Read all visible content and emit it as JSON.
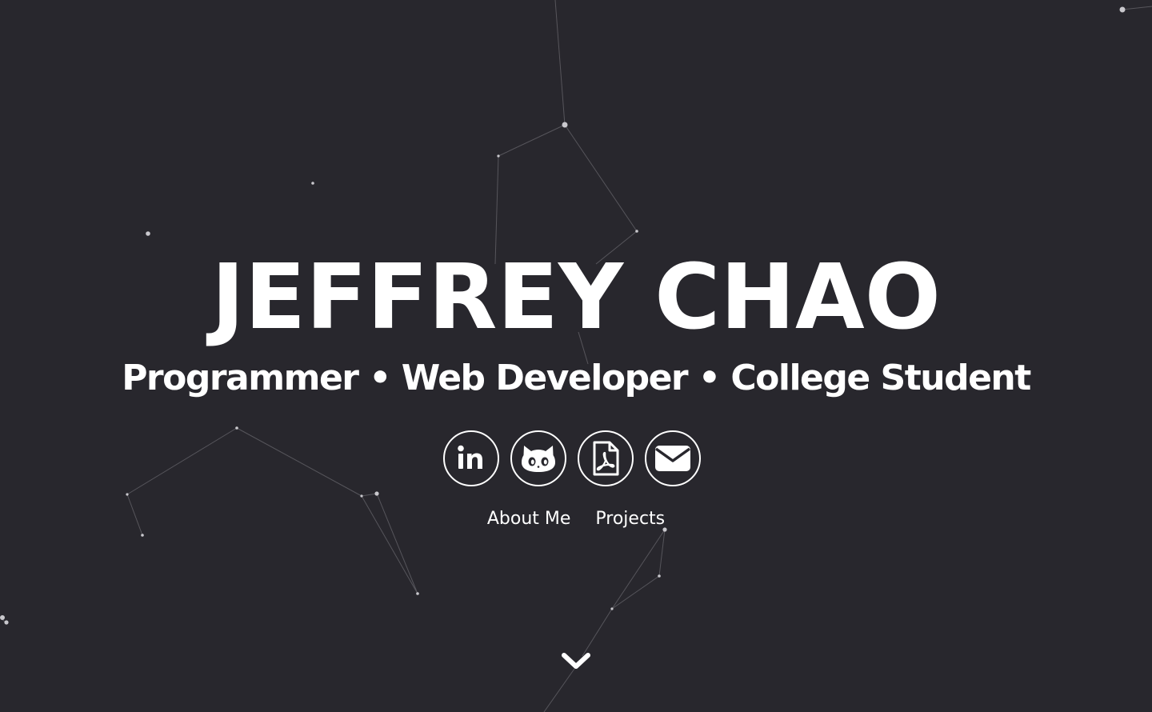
{
  "hero": {
    "name": "JEFFREY CHAO",
    "tagline": "Programmer • Web Developer • College Student"
  },
  "socials": [
    {
      "icon": "linkedin-icon"
    },
    {
      "icon": "github-icon"
    },
    {
      "icon": "pdf-resume-icon"
    },
    {
      "icon": "email-icon"
    }
  ],
  "nav": {
    "about_label": "About Me",
    "projects_label": "Projects"
  },
  "scroll": {
    "icon": "chevron-down-icon"
  },
  "colors": {
    "background": "#28272d",
    "foreground": "#ffffff",
    "particle_line": "#6b6a70"
  }
}
